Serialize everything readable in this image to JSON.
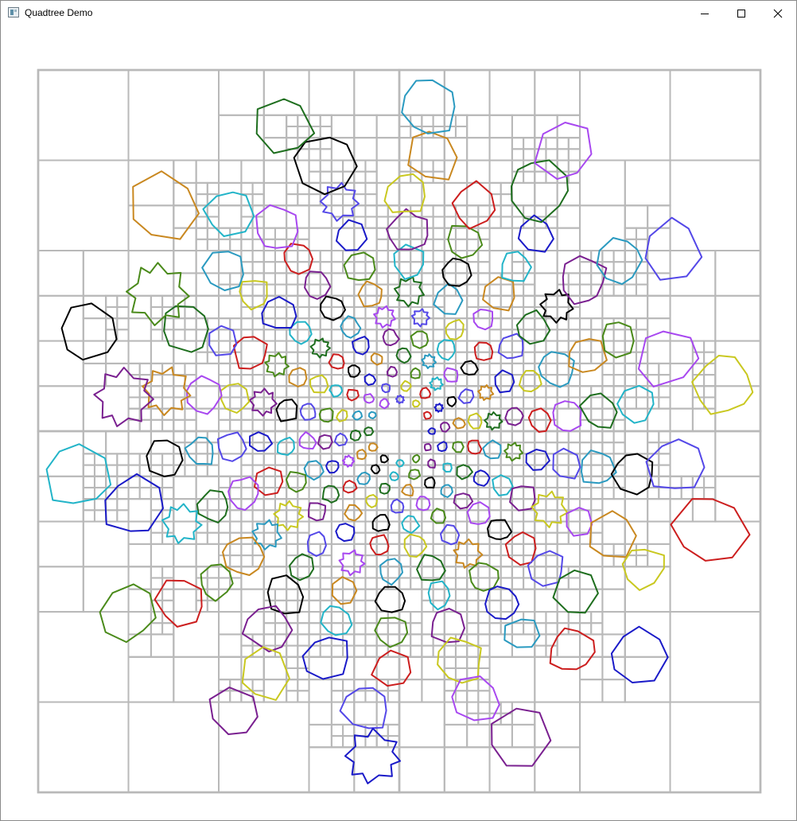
{
  "window": {
    "title": "Quadtree Demo"
  },
  "icons": {
    "app": "window-app-icon",
    "minimize": "minimize-icon",
    "maximize": "maximize-icon",
    "close": "close-icon"
  },
  "colors": {
    "grid": "#b9b9b9",
    "palette": [
      "#1a1ac8",
      "#c98820",
      "#c9c820",
      "#22b4c8",
      "#a848f0",
      "#7a2090",
      "#1e6e1e",
      "#cc1e1e",
      "#000000",
      "#5448e8",
      "#4a8a1a",
      "#2a9ac0"
    ]
  },
  "scene": {
    "rings": [
      {
        "count": 12,
        "radius": 40,
        "size": 5
      },
      {
        "count": 14,
        "radius": 57,
        "size": 6
      },
      {
        "count": 16,
        "radius": 75,
        "size": 7
      },
      {
        "count": 18,
        "radius": 95,
        "size": 8.5
      },
      {
        "count": 20,
        "radius": 118,
        "size": 10.5
      },
      {
        "count": 20,
        "radius": 145,
        "size": 13
      },
      {
        "count": 22,
        "radius": 176,
        "size": 16
      },
      {
        "count": 22,
        "radius": 212,
        "size": 19
      },
      {
        "count": 22,
        "radius": 252,
        "size": 22
      },
      {
        "count": 22,
        "radius": 298,
        "size": 26
      },
      {
        "count": 16,
        "radius": 350,
        "size": 33
      },
      {
        "count": 14,
        "radius": 410,
        "size": 40
      }
    ]
  }
}
